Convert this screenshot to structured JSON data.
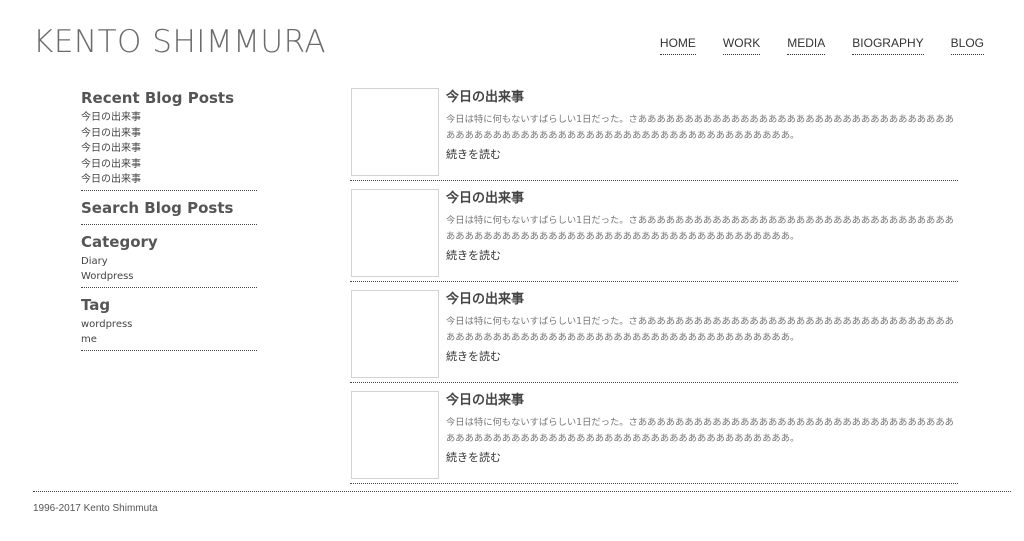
{
  "header": {
    "site_title": "KENTO SHIMMURA",
    "nav": [
      {
        "label": "HOME"
      },
      {
        "label": "WORK"
      },
      {
        "label": "MEDIA"
      },
      {
        "label": "BIOGRAPHY"
      },
      {
        "label": "BLOG"
      }
    ]
  },
  "sidebar": {
    "recent": {
      "title": "Recent Blog Posts",
      "items": [
        "今日の出来事",
        "今日の出来事",
        "今日の出来事",
        "今日の出来事",
        "今日の出来事"
      ]
    },
    "search": {
      "title": "Search Blog Posts"
    },
    "category": {
      "title": "Category",
      "items": [
        "Diary",
        "Wordpress"
      ]
    },
    "tag": {
      "title": "Tag",
      "items": [
        "wordpress",
        "me"
      ]
    }
  },
  "posts": [
    {
      "title": "今日の出来事",
      "excerpt": "今日は特に何もないすばらしい1日だった。さあああああああああああああああああああああああああああああああああああああああああああああああああああああああああああああああああああああああ。",
      "more": "続きを読む"
    },
    {
      "title": "今日の出来事",
      "excerpt": "今日は特に何もないすばらしい1日だった。さあああああああああああああああああああああああああああああああああああああああああああああああああああああああああああああああああああああああ。",
      "more": "続きを読む"
    },
    {
      "title": "今日の出来事",
      "excerpt": "今日は特に何もないすばらしい1日だった。さあああああああああああああああああああああああああああああああああああああああああああああああああああああああああああああああああああああああ。",
      "more": "続きを読む"
    },
    {
      "title": "今日の出来事",
      "excerpt": "今日は特に何もないすばらしい1日だった。さあああああああああああああああああああああああああああああああああああああああああああああああああああああああああああああああああああああああ。",
      "more": "続きを読む"
    }
  ],
  "footer": {
    "text": "1996-2017 Kento Shimmuta"
  }
}
